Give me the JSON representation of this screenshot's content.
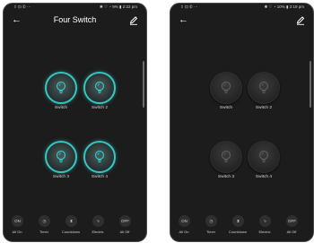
{
  "screens": [
    {
      "state": "on",
      "status": {
        "left": "⇪ ⊡ ✆ ···",
        "right": "✱ ♡ ◔ 9% ▮ 2:22 pm"
      },
      "header": {
        "back_icon": "←",
        "title": "Four Switch",
        "edit_icon": "edit-icon"
      },
      "switches": [
        {
          "label": "Switch",
          "state": "on"
        },
        {
          "label": "Switch 2",
          "state": "on"
        },
        {
          "label": "Switch 3",
          "state": "on"
        },
        {
          "label": "Switch 4",
          "state": "on"
        }
      ],
      "bottom": [
        {
          "icon": "ON",
          "label": "All On"
        },
        {
          "icon": "◷",
          "label": "Timer"
        },
        {
          "icon": "⧗",
          "label": "Countdown"
        },
        {
          "icon": "ϟ",
          "label": "Electric"
        },
        {
          "icon": "OFF",
          "label": "All Off"
        }
      ]
    },
    {
      "state": "off",
      "status": {
        "left": "⇪ ⊡ ✆ ···",
        "right": "✱ ♡ ◔ 10% ▮ 2:19 pm"
      },
      "header": {
        "back_icon": "←",
        "title": "",
        "edit_icon": "edit-icon"
      },
      "switches": [
        {
          "label": "Switch",
          "state": "off"
        },
        {
          "label": "Switch 2",
          "state": "off"
        },
        {
          "label": "Switch 3",
          "state": "off"
        },
        {
          "label": "Switch 4",
          "state": "off"
        }
      ],
      "bottom": [
        {
          "icon": "ON",
          "label": "All On"
        },
        {
          "icon": "◷",
          "label": "Timer"
        },
        {
          "icon": "⧗",
          "label": "Countdown"
        },
        {
          "icon": "ϟ",
          "label": "Electric"
        },
        {
          "icon": "OFF",
          "label": "All Off"
        }
      ]
    }
  ],
  "colors": {
    "accent": "#35c6c0",
    "background": "#1c1c1c",
    "text": "#ffffff"
  }
}
